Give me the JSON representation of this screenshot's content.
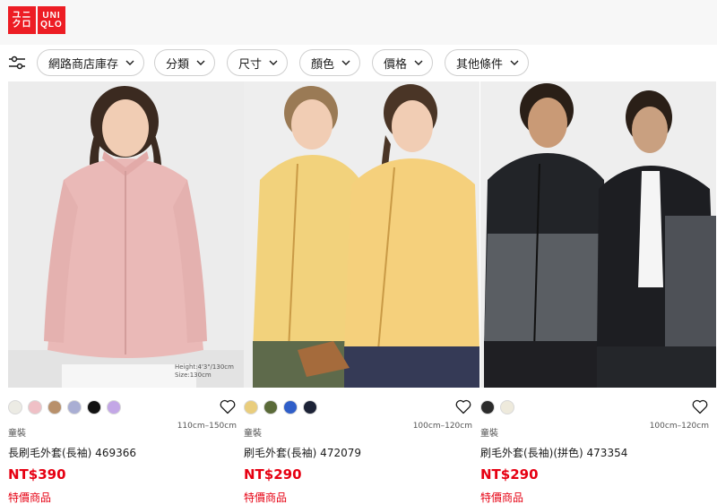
{
  "brand": {
    "line1": "ユニ",
    "line2": "クロ",
    "line3": "UNI",
    "line4": "QLO",
    "color": "#ed1d24"
  },
  "filters": [
    {
      "label": "網路商店庫存"
    },
    {
      "label": "分類"
    },
    {
      "label": "尺寸"
    },
    {
      "label": "顏色"
    },
    {
      "label": "價格"
    },
    {
      "label": "其他條件"
    }
  ],
  "products": [
    {
      "category": "童裝",
      "size": "110cm–150cm",
      "name": "長刷毛外套(長袖) 469366",
      "price": "NT$390",
      "promo": "特價商品",
      "image_note": "Height:4'3\"/130cm Size:130cm",
      "swatches": [
        "#ecebe4",
        "#efc0c6",
        "#b8906b",
        "#a9aed3",
        "#111111",
        "#c3a7e6"
      ]
    },
    {
      "category": "童裝",
      "size": "100cm–120cm",
      "name": "刷毛外套(長袖) 472079",
      "price": "NT$290",
      "promo": "特價商品",
      "swatches": [
        "#e9cd7d",
        "#5a6a38",
        "#2f5ec8",
        "#1c2236"
      ]
    },
    {
      "category": "童裝",
      "size": "100cm–120cm",
      "name": "刷毛外套(長袖)(拼色) 473354",
      "price": "NT$290",
      "promo": "特價商品",
      "swatches": [
        "#2b2b2b",
        "#eeeadc"
      ]
    }
  ],
  "colors": {
    "price": "#e60012",
    "promo": "#e60012"
  }
}
